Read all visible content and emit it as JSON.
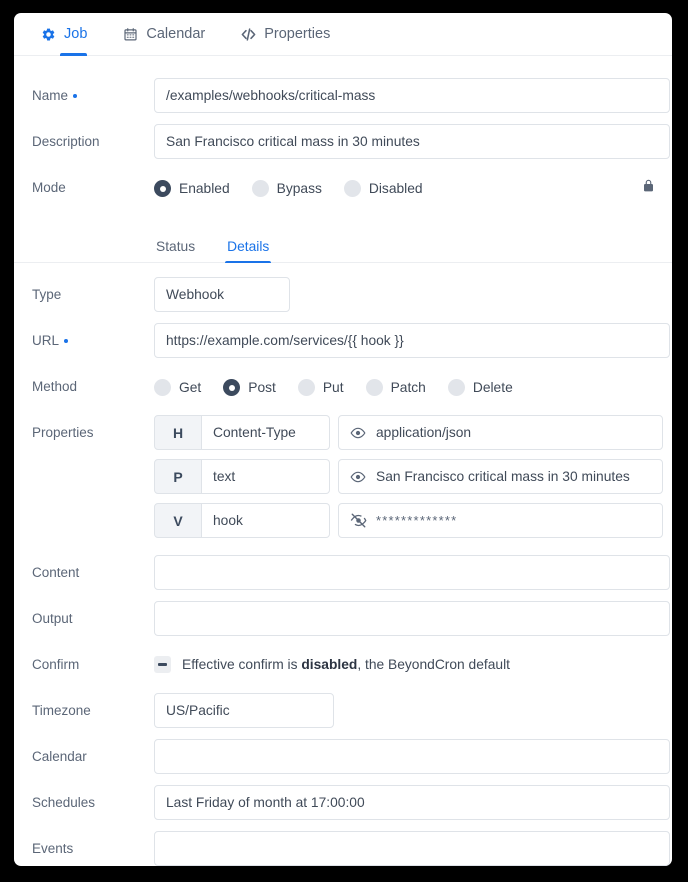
{
  "tabs": [
    {
      "label": "Job",
      "icon": "gear-icon",
      "active": true
    },
    {
      "label": "Calendar",
      "icon": "calendar-icon",
      "active": false
    },
    {
      "label": "Properties",
      "icon": "code-icon",
      "active": false
    }
  ],
  "subtabs": [
    {
      "label": "Status",
      "active": false
    },
    {
      "label": "Details",
      "active": true
    }
  ],
  "form": {
    "name": {
      "label": "Name",
      "value": "/examples/webhooks/critical-mass",
      "required": true
    },
    "description": {
      "label": "Description",
      "value": "San Francisco critical mass in 30 minutes",
      "required": false
    },
    "mode": {
      "label": "Mode",
      "options": [
        "Enabled",
        "Bypass",
        "Disabled"
      ],
      "selected": "Enabled",
      "lock_icon": "lock-icon"
    },
    "type": {
      "label": "Type",
      "value": "Webhook"
    },
    "url": {
      "label": "URL",
      "value": "https://example.com/services/{{ hook }}",
      "required": true
    },
    "method": {
      "label": "Method",
      "options": [
        "Get",
        "Post",
        "Put",
        "Patch",
        "Delete"
      ],
      "selected": "Post"
    },
    "properties": {
      "label": "Properties",
      "rows": [
        {
          "key": "H",
          "name": "Content-Type",
          "value": "application/json",
          "eye": "eye-icon",
          "hidden": false
        },
        {
          "key": "P",
          "name": "text",
          "value": "San Francisco critical mass in 30 minutes",
          "eye": "eye-icon",
          "hidden": false
        },
        {
          "key": "V",
          "name": "hook",
          "value": "*************",
          "eye": "eye-off-icon",
          "hidden": true
        }
      ]
    },
    "content": {
      "label": "Content",
      "value": ""
    },
    "output": {
      "label": "Output",
      "value": ""
    },
    "confirm": {
      "label": "Confirm",
      "text_before": "Effective confirm is ",
      "text_bold": "disabled",
      "text_after": ", the BeyondCron default",
      "state_icon": "minus-checkbox-icon"
    },
    "timezone": {
      "label": "Timezone",
      "value": "US/Pacific"
    },
    "calendar": {
      "label": "Calendar",
      "value": ""
    },
    "schedules": {
      "label": "Schedules",
      "value": "Last Friday of month at 17:00:00"
    },
    "events": {
      "label": "Events",
      "value": ""
    }
  },
  "colors": {
    "accent": "#1a73e8",
    "label": "#5b6677",
    "text": "#404a58",
    "border": "#dfe3e8",
    "radio_selected": "#3c4a5e"
  }
}
